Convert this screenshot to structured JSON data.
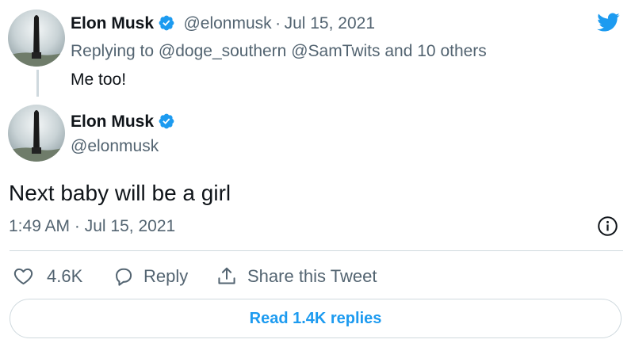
{
  "reply_tweet": {
    "author_name": "Elon Musk",
    "handle": "@elonmusk",
    "separator": "·",
    "date": "Jul 15, 2021",
    "replying_prefix": "Replying to",
    "replying_user1": "@doge_southern",
    "replying_user2": "@SamTwits",
    "replying_suffix": "and 10 others",
    "text": "Me too!"
  },
  "main_tweet": {
    "author_name": "Elon Musk",
    "handle": "@elonmusk",
    "text": "Next baby will be a girl",
    "time": "1:49 AM",
    "separator": "·",
    "date": "Jul 15, 2021"
  },
  "actions": {
    "like_count": "4.6K",
    "reply_label": "Reply",
    "share_label": "Share this Tweet"
  },
  "footer": {
    "read_replies_label": "Read 1.4K replies"
  },
  "icons": {
    "brand": "twitter-bird-icon",
    "verified": "verified-badge-icon",
    "info": "info-icon",
    "like": "heart-icon",
    "reply": "speech-bubble-icon",
    "share": "share-upload-icon"
  },
  "colors": {
    "accent": "#1d9bf0",
    "text": "#0f1419",
    "muted": "#536471",
    "border": "#cfd9de"
  }
}
